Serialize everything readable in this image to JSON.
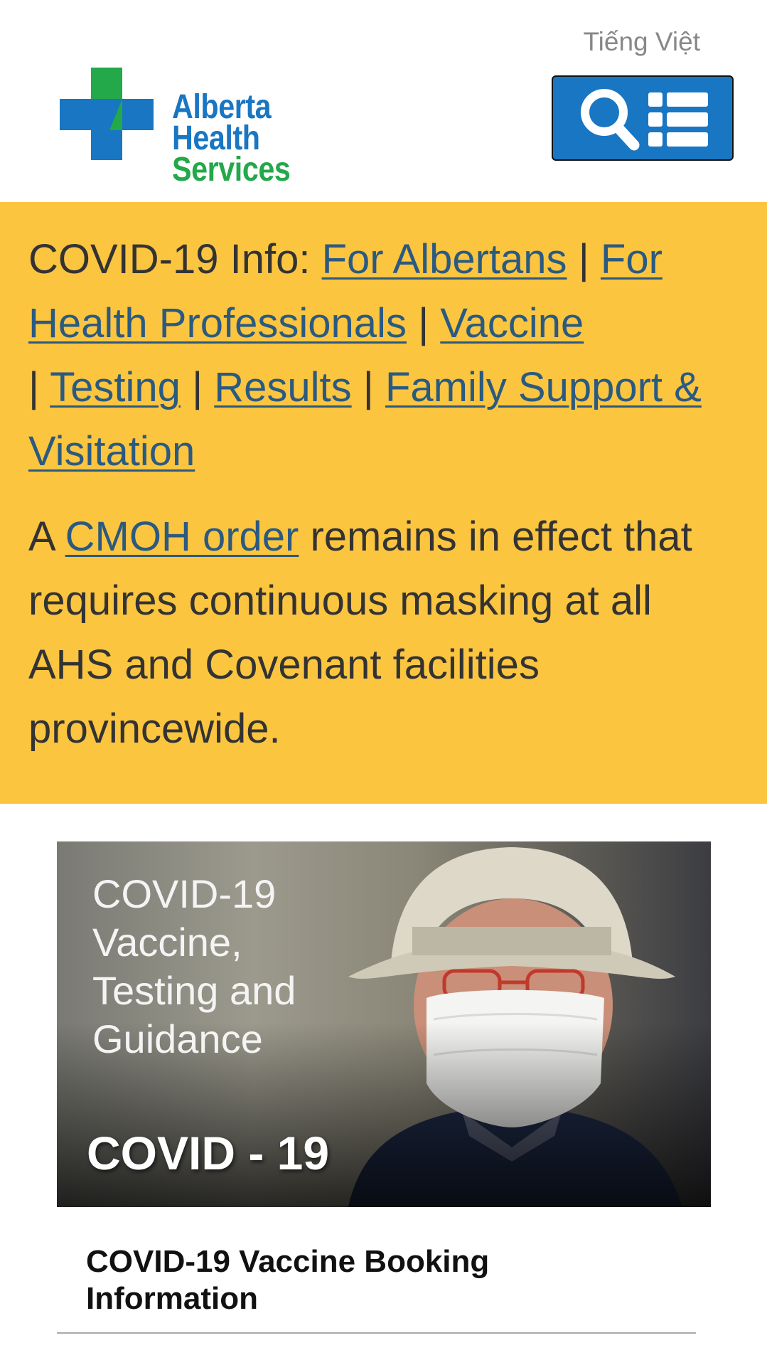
{
  "header": {
    "language_link": "Tiếng Việt",
    "logo": {
      "line1": "Alberta Health",
      "line2": "Services",
      "brand_blue": "#1976c2",
      "brand_green": "#23a84a"
    },
    "nav_button": {
      "icons": [
        "search-icon",
        "menu-list-icon"
      ],
      "color": "#1976c2"
    }
  },
  "alert": {
    "background": "#fcc540",
    "covid_prefix": "COVID-19 Info:",
    "links": [
      "For Albertans",
      "For Health Professionals",
      "Vaccine",
      "Testing",
      "Results",
      "Family Support & Visitation"
    ],
    "separator": "|",
    "order": {
      "prefix": "A",
      "link": "CMOH order",
      "suffix": "remains in effect that requires continuous masking at all AHS and Covenant facilities provincewide."
    }
  },
  "hero": {
    "caption": "COVID-19\nVaccine,\nTesting and\nGuidance",
    "label": "COVID - 19"
  },
  "card": {
    "title": "COVID-19 Vaccine Booking Information"
  }
}
